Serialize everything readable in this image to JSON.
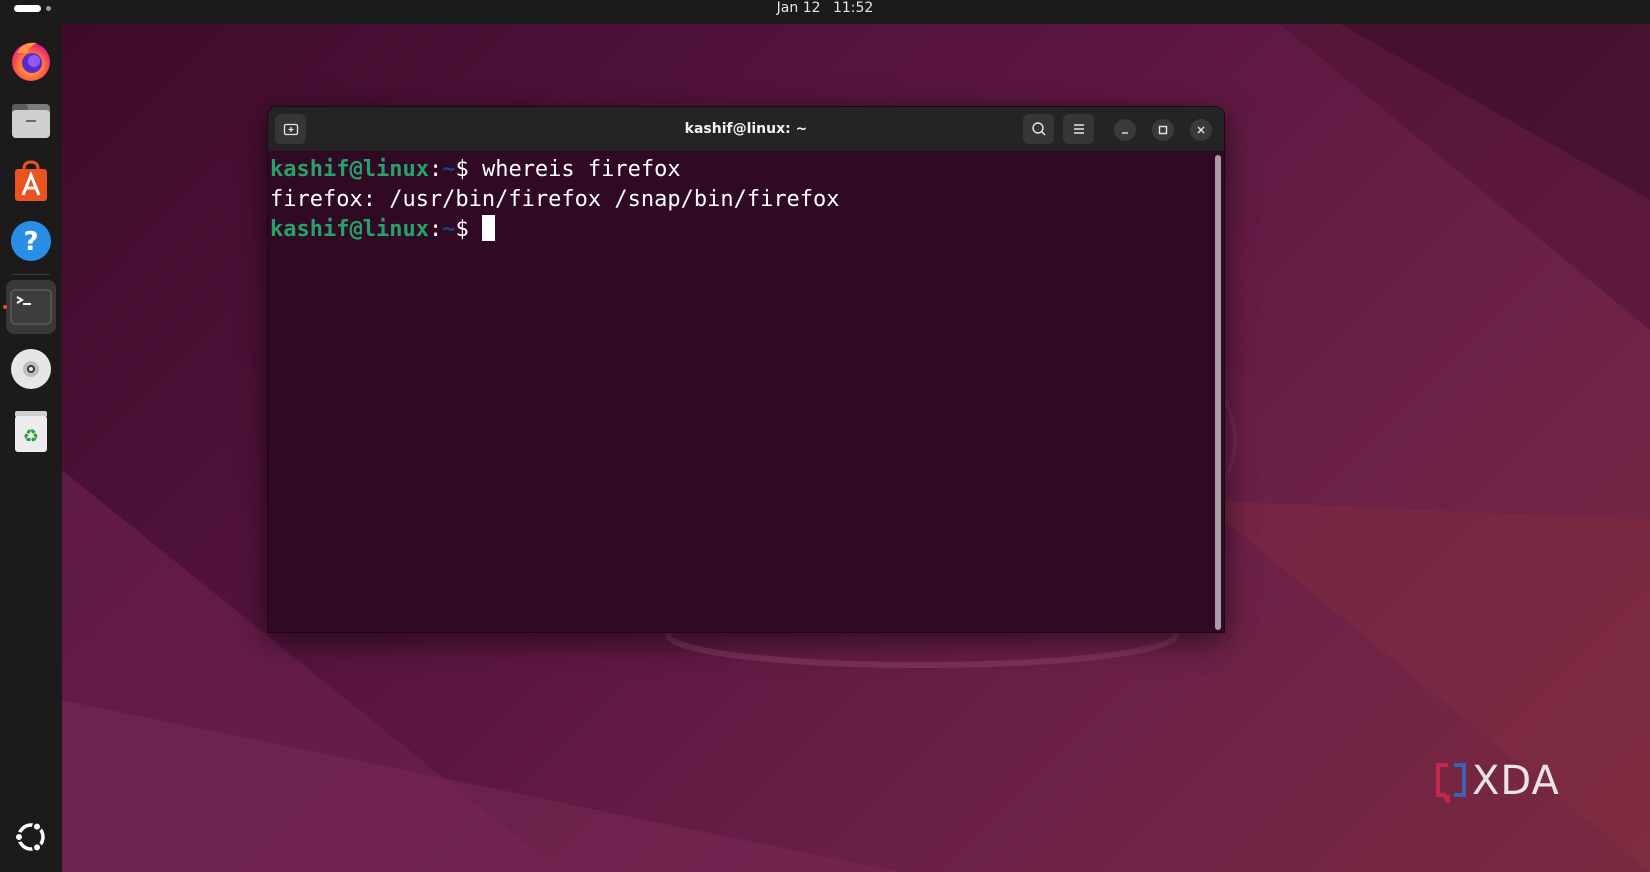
{
  "topbar": {
    "date": "Jan 12",
    "time": "11:52"
  },
  "dock": {
    "items": [
      {
        "name": "firefox-icon"
      },
      {
        "name": "files-icon"
      },
      {
        "name": "app-center-icon"
      },
      {
        "name": "help-icon"
      },
      {
        "name": "terminal-icon",
        "active": true
      },
      {
        "name": "disc-icon"
      },
      {
        "name": "trash-icon"
      }
    ],
    "show_apps_icon": "ubuntu-logo-icon"
  },
  "terminal": {
    "title": "kashif@linux: ~",
    "lines": [
      {
        "user": "kashif@linux",
        "colon": ":",
        "path": "~",
        "prompt": "$ ",
        "command": "whereis firefox"
      },
      {
        "output": "firefox: /usr/bin/firefox /snap/bin/firefox"
      },
      {
        "user": "kashif@linux",
        "colon": ":",
        "path": "~",
        "prompt": "$ ",
        "command": ""
      }
    ]
  },
  "watermark": {
    "text": "XDA"
  },
  "colors": {
    "prompt_user": "#26a269",
    "prompt_path": "#12488b",
    "terminal_bg": "#300a24",
    "accent": "#e95420"
  }
}
